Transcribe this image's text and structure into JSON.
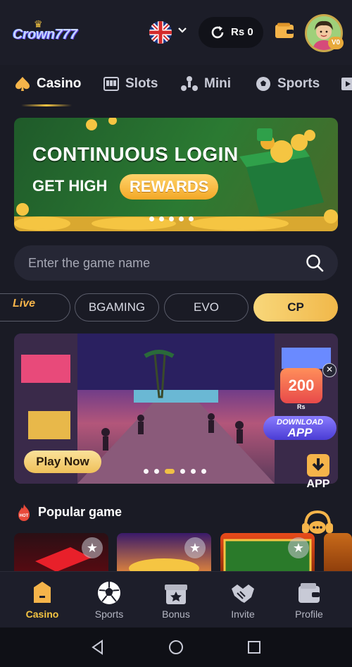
{
  "header": {
    "logo_text": "Crown777",
    "balance": "Rs 0",
    "vip_badge": "V0"
  },
  "categories": [
    {
      "label": "Casino",
      "icon": "spade-icon",
      "active": true
    },
    {
      "label": "Slots",
      "icon": "slot-machine-icon",
      "active": false
    },
    {
      "label": "Mini",
      "icon": "mini-games-icon",
      "active": false
    },
    {
      "label": "Sports",
      "icon": "soccer-ball-icon",
      "active": false
    }
  ],
  "banner": {
    "title": "CONTINUOUS LOGIN",
    "subtitle": "GET HIGH",
    "highlight": "REWARDS"
  },
  "search": {
    "placeholder": "Enter the game name"
  },
  "providers": {
    "live_label": "Live",
    "chips": [
      "BGAMING",
      "EVO",
      "CP"
    ],
    "active": "CP"
  },
  "promo": {
    "play_button": "Play Now",
    "download_amount": "200",
    "download_currency": "Rs",
    "download_line1": "DOWNLOAD",
    "download_line2": "APP",
    "app_label": "APP"
  },
  "popular": {
    "title": "Popular game",
    "hot_label": "HOT"
  },
  "bottom_nav": [
    {
      "label": "Casino",
      "icon": "casino-icon",
      "active": true
    },
    {
      "label": "Sports",
      "icon": "soccer-ball-icon",
      "active": false
    },
    {
      "label": "Bonus",
      "icon": "gift-icon",
      "active": false
    },
    {
      "label": "Invite",
      "icon": "handshake-icon",
      "active": false
    },
    {
      "label": "Profile",
      "icon": "wallet-icon",
      "active": false
    }
  ],
  "colors": {
    "background": "#1a1b25",
    "accent": "#f5c542",
    "surface": "#262735"
  }
}
